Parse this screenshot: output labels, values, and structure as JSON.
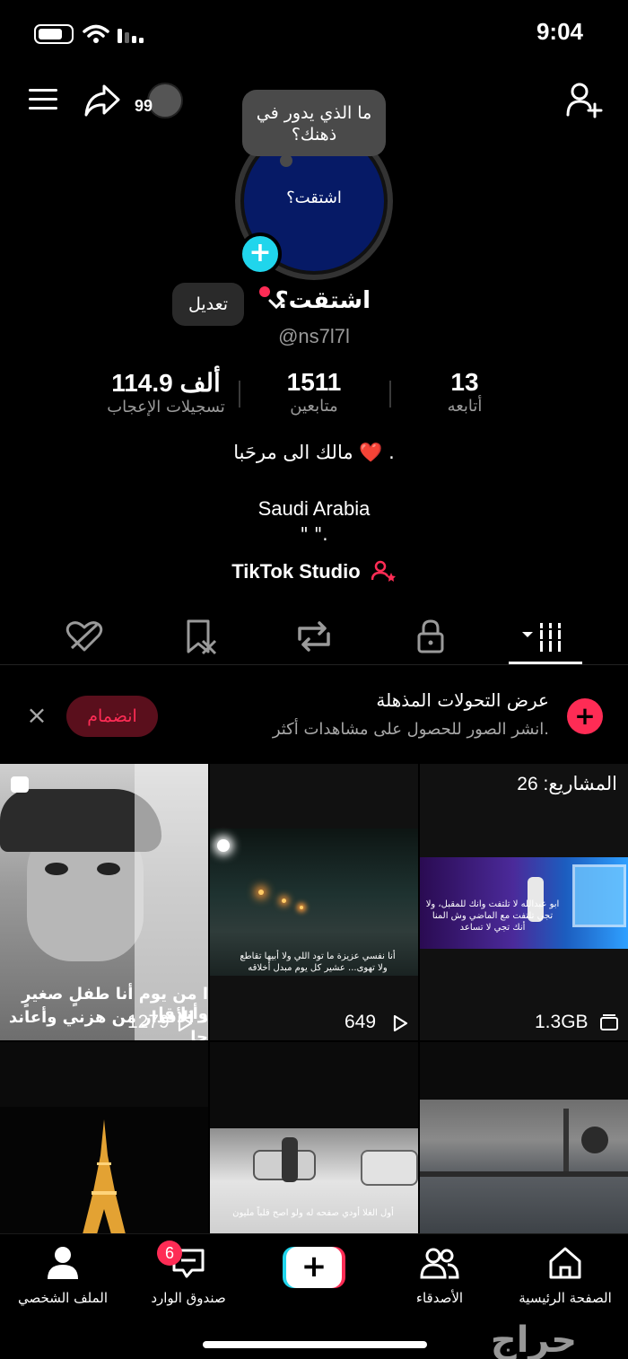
{
  "status_bar": {
    "time": "9:04"
  },
  "header": {
    "share_count": "99"
  },
  "profile": {
    "thought_bubble": "ما الذي يدور في ذهنك؟",
    "avatar_text": "اشتقت؟",
    "display_name": "اشتقت؟",
    "edit_label": "تعديل",
    "handle": "@ns7l7l"
  },
  "stats": [
    {
      "value": "13",
      "label": "أتابعه"
    },
    {
      "value": "1511",
      "label": "متابعين"
    },
    {
      "value": "114.9 ألف",
      "label": "تسجيلات الإعجاب"
    }
  ],
  "bio": {
    "line1": "مالك الى مرحَبا ❤️ .",
    "line2": "Saudi Arabia",
    "line3": "\"                    \".",
    "studio": "TikTok Studio"
  },
  "promo": {
    "title": "عرض التحولات المذهلة",
    "subtitle": "انشر الصور للحصول على مشاهدات أكثر.",
    "join_label": "انضمام",
    "close": "×"
  },
  "grid": {
    "drafts_label": "المشاريع: 26",
    "storage": "1.3GB",
    "video2_views": "649",
    "video3_views": "1279",
    "video3_caption_1": "ا من يوم أنا طفلٍ صغيرٍ وأنا قا",
    "video3_caption_2": "د الأقدار من هزني وأعاند جا",
    "drafts_caption": "ابو عبدالله لا تلتفت وانك للمقبل، ولا تجي تلتفت مع الماضي وش المنا أنك تجي لا تساعد",
    "video2_caption_1": "أنا نفسي عزيزة ما تود اللي ولا أبيها تقاطع",
    "video2_caption_2": "ولا تهوى... عشير كل يوم مبدل أخلاقه",
    "video5_caption": "أول الغلا أودي صفحه له ولو اصح قلباً مليون"
  },
  "nav": {
    "home": "الصفحة الرئيسية",
    "friends": "الأصدقاء",
    "inbox": "صندوق الوارد",
    "inbox_badge": "6",
    "profile": "الملف الشخصي"
  },
  "watermark": "حراج",
  "colors": {
    "accent": "#fe2c55",
    "cyan": "#20d5ec",
    "bg": "#000000"
  }
}
